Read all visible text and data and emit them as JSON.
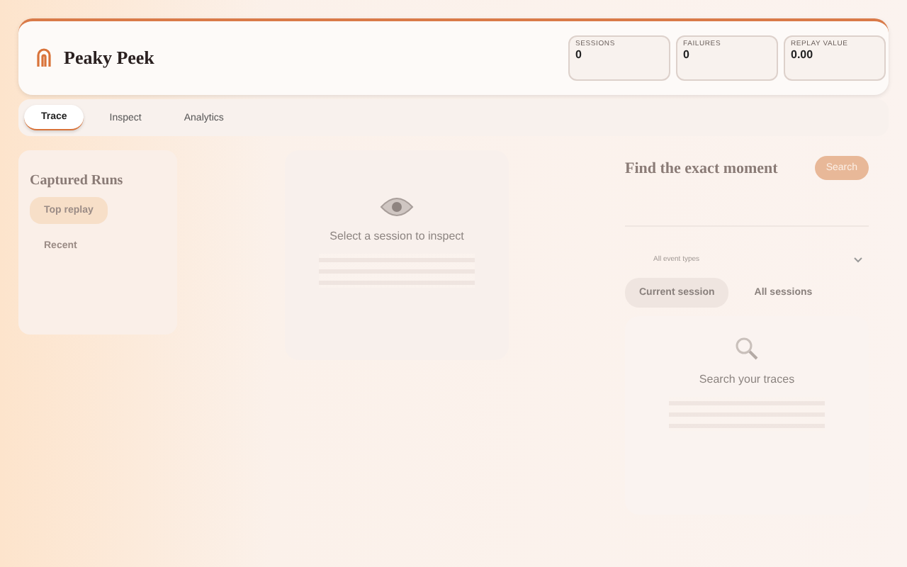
{
  "app": {
    "title": "Peaky Peek"
  },
  "stats": [
    {
      "label": "SESSIONS",
      "value": "0"
    },
    {
      "label": "FAILURES",
      "value": "0"
    },
    {
      "label": "REPLAY VALUE",
      "value": "0.00"
    }
  ],
  "tabs": [
    {
      "label": "Trace",
      "selected": true
    },
    {
      "label": "Inspect",
      "selected": false
    },
    {
      "label": "Analytics",
      "selected": false
    }
  ],
  "runs": {
    "title": "Captured Runs",
    "filters": [
      {
        "label": "Top replay",
        "selected": true
      },
      {
        "label": "Recent",
        "selected": false
      }
    ]
  },
  "inspector": {
    "title": "Select a session to inspect"
  },
  "search": {
    "title": "Find the exact moment",
    "button": "Search",
    "event_select": "All event types",
    "scopes": [
      {
        "label": "Current session",
        "selected": true
      },
      {
        "label": "All sessions",
        "selected": false
      }
    ],
    "empty_title": "Search your traces"
  }
}
